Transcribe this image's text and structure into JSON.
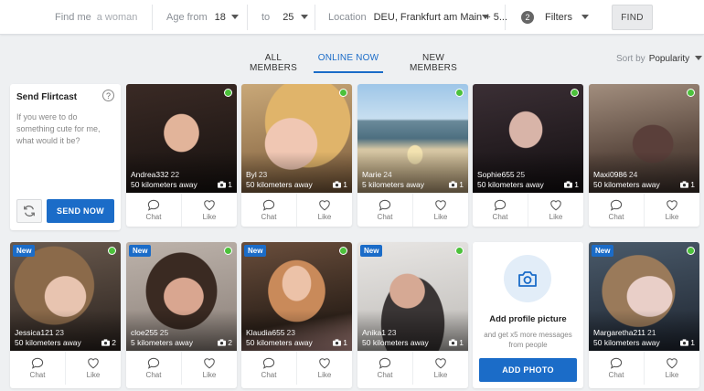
{
  "filters": {
    "find_me_label": "Find me",
    "find_me_placeholder": "a woman",
    "age_from_label": "Age from",
    "age_from_value": "18",
    "age_to_label": "to",
    "age_to_value": "25",
    "location_label": "Location",
    "location_value": "DEU, Frankfurt am Main + 5...",
    "filters_count": "2",
    "filters_label": "Filters",
    "find_button": "FIND"
  },
  "tabs": [
    {
      "label": "ALL MEMBERS",
      "active": false
    },
    {
      "label": "ONLINE NOW",
      "active": true
    },
    {
      "label": "NEW MEMBERS",
      "active": false
    }
  ],
  "sort": {
    "label": "Sort by",
    "value": "Popularity"
  },
  "flirtcast": {
    "title": "Send Flirtcast",
    "help": "?",
    "prompt": "If you were to do something cute for me, what would it be?",
    "send_button": "SEND NOW"
  },
  "add_photo": {
    "title": "Add profile picture",
    "subtitle": "and get x5 more messages from people",
    "button": "ADD PHOTO"
  },
  "card_actions": {
    "chat": "Chat",
    "like": "Like"
  },
  "new_badge": "New",
  "members": [
    {
      "name": "Andrea332",
      "age": "22",
      "distance": "50 kilometers away",
      "photos": "1",
      "is_new": false,
      "online": true
    },
    {
      "name": "Byl",
      "age": "23",
      "distance": "50 kilometers away",
      "photos": "1",
      "is_new": false,
      "online": true
    },
    {
      "name": "Marie",
      "age": "24",
      "distance": "5 kilometers away",
      "photos": "1",
      "is_new": false,
      "online": true
    },
    {
      "name": "Sophie655",
      "age": "25",
      "distance": "50 kilometers away",
      "photos": "1",
      "is_new": false,
      "online": true
    },
    {
      "name": "Maxi0986",
      "age": "24",
      "distance": "50 kilometers away",
      "photos": "1",
      "is_new": false,
      "online": true
    },
    {
      "name": "Jessica121",
      "age": "23",
      "distance": "50 kilometers away",
      "photos": "2",
      "is_new": true,
      "online": true
    },
    {
      "name": "cloe255",
      "age": "25",
      "distance": "5 kilometers away",
      "photos": "2",
      "is_new": true,
      "online": true
    },
    {
      "name": "Klaudia655",
      "age": "23",
      "distance": "50 kilometers away",
      "photos": "1",
      "is_new": true,
      "online": true
    },
    {
      "name": "Anika1",
      "age": "23",
      "distance": "50 kilometers away",
      "photos": "1",
      "is_new": true,
      "online": true
    },
    {
      "name": "Margaretha211",
      "age": "21",
      "distance": "50 kilometers away",
      "photos": "1",
      "is_new": true,
      "online": true
    }
  ],
  "colors": {
    "accent": "#1b6cc8",
    "online": "#4cc13b"
  }
}
